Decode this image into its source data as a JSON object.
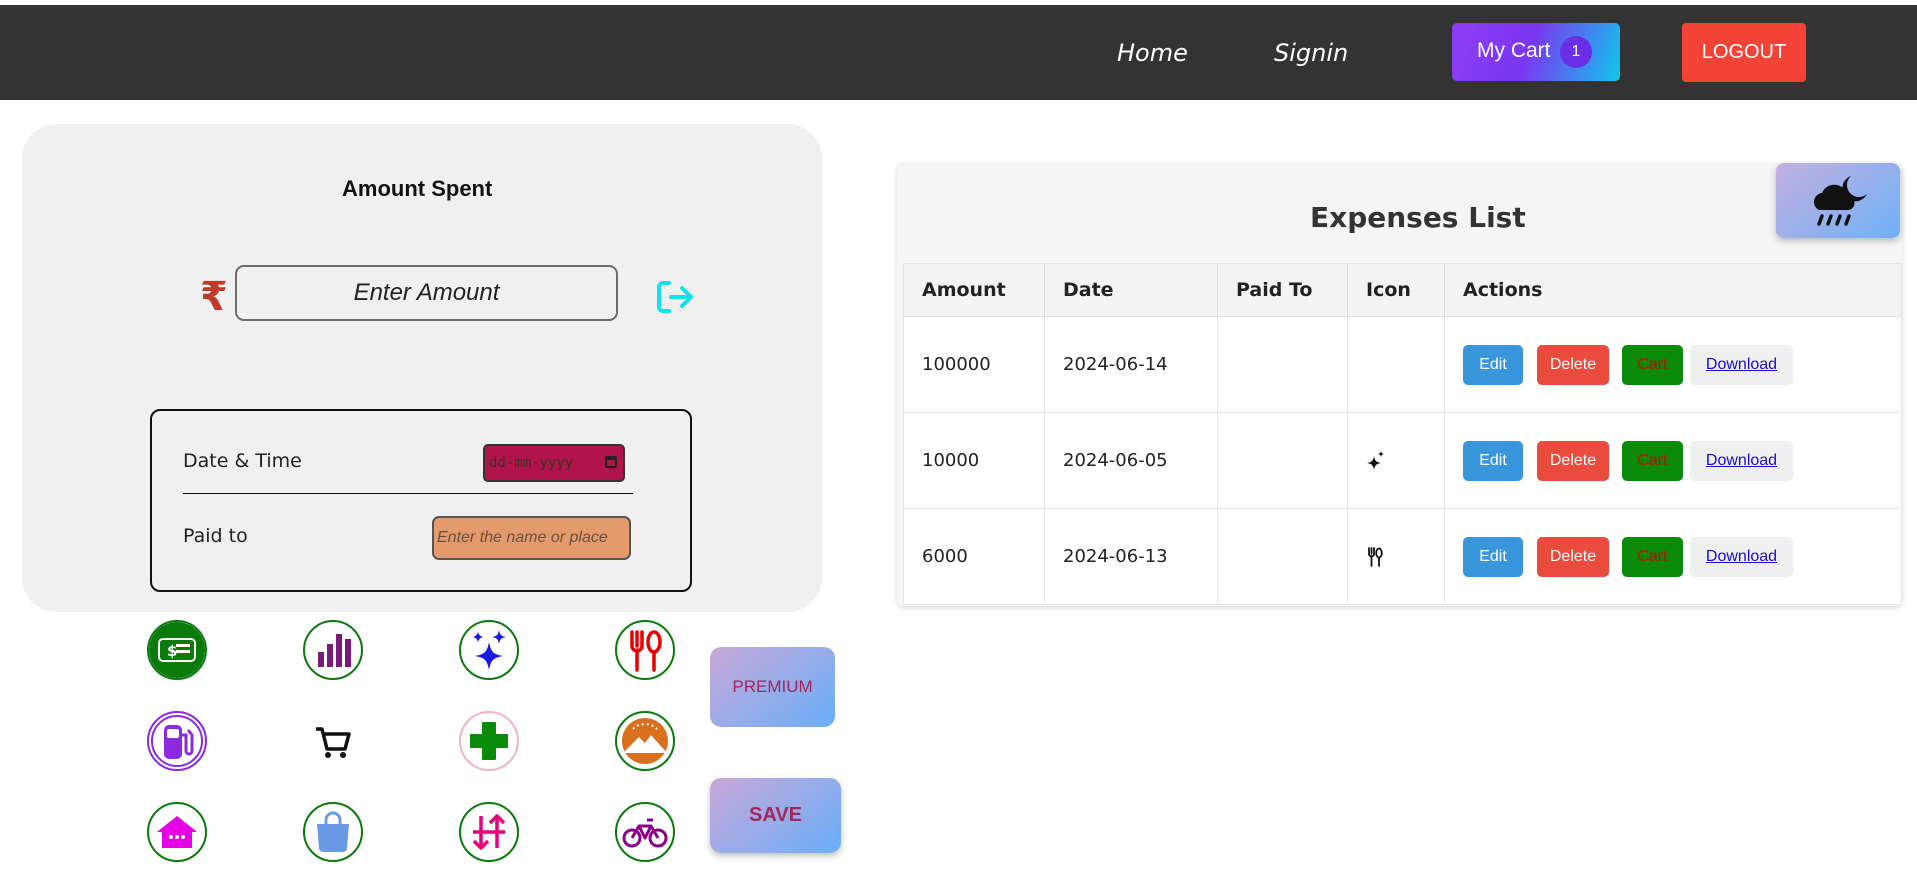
{
  "nav": {
    "home": "Home",
    "signin": "Signin",
    "cart_label": "My Cart",
    "cart_count": "1",
    "logout": "LOGOUT"
  },
  "amount_card": {
    "title": "Amount Spent",
    "currency_symbol": "₹",
    "amount_placeholder": "Enter Amount",
    "date_label": "Date & Time",
    "date_placeholder": "dd-mm-yyyy",
    "paidto_label": "Paid to",
    "paidto_placeholder": "Enter the name or place"
  },
  "categories": [
    {
      "icon": "money-icon",
      "color": "#0a7a0a"
    },
    {
      "icon": "bar-chart-icon",
      "color": "#7a1a7a"
    },
    {
      "icon": "sparkles-icon",
      "color": "#1a1ae6"
    },
    {
      "icon": "restaurant-icon",
      "color": "#e60000"
    },
    {
      "icon": "fuel-icon",
      "color": "#8a2be2"
    },
    {
      "icon": "shopping-cart-icon",
      "color": "#111111"
    },
    {
      "icon": "medical-cross-icon",
      "color": "#0a8a0a"
    },
    {
      "icon": "mountain-icon",
      "color": "#d8701e"
    },
    {
      "icon": "house-icon",
      "color": "#e600e6"
    },
    {
      "icon": "shopping-bag-icon",
      "color": "#6a9ae6"
    },
    {
      "icon": "transfer-arrows-icon",
      "color": "#e6007a"
    },
    {
      "icon": "bicycle-icon",
      "color": "#8a008a"
    }
  ],
  "buttons": {
    "premium": "PREMIUM",
    "save": "SAVE"
  },
  "expenses": {
    "title": "Expenses List",
    "headers": [
      "Amount",
      "Date",
      "Paid To",
      "Icon",
      "Actions"
    ],
    "rows": [
      {
        "amount": "100000",
        "date": "2024-06-14",
        "paid_to": "",
        "icon": ""
      },
      {
        "amount": "10000",
        "date": "2024-06-05",
        "paid_to": "",
        "icon": "sparkles-icon"
      },
      {
        "amount": "6000",
        "date": "2024-06-13",
        "paid_to": "",
        "icon": "restaurant-icon"
      }
    ],
    "actions": {
      "edit": "Edit",
      "delete": "Delete",
      "cart": "Cart",
      "download": "Download"
    }
  },
  "theme_toggle_icon": "weather-night-rain-icon"
}
